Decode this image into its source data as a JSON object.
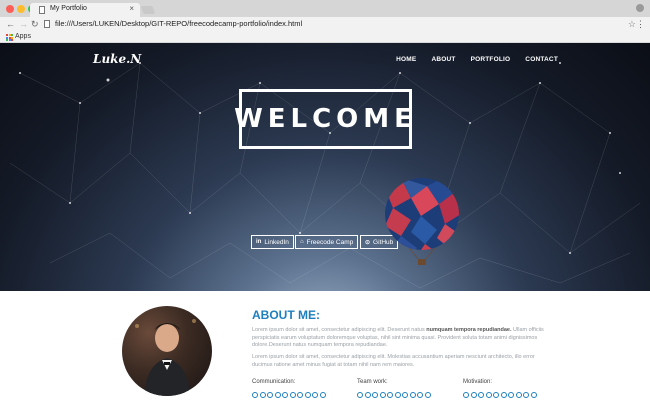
{
  "browser": {
    "tab_title": "My Portfolio",
    "url": "file:///Users/LUKEN/Desktop/GIT-REPO/freecodecamp-portfolio/index.html",
    "bookmarks": {
      "apps_label": "Apps"
    }
  },
  "site": {
    "brand": "Luke.N",
    "nav": [
      "HOME",
      "ABOUT",
      "PORTFOLIO",
      "CONTACT"
    ],
    "hero_title": "WELCOME",
    "social": [
      {
        "label": "LinkedIn",
        "icon": "in"
      },
      {
        "label": "Freecode Camp",
        "icon": "⌂"
      },
      {
        "label": "GitHub",
        "icon": "⊙"
      }
    ]
  },
  "about": {
    "title": "ABOUT ME:",
    "para1_start": "Lorem ipsum dolor sit amet, consectetur adipiscing elit. Deserunt natus ",
    "para1_bold": "numquam tempora repudiandae.",
    "para1_end": " Ullam officiis perspiciatis earum voluptatum doloremque voluptas, nihil sint minima quasi. Provident soluta totam animi dignissimos dolore.Deserunt natus numquam tempora repudiandae.",
    "para2": "Lorem ipsum dolor sit amet, consectetur adipiscing elit. Molestias accusantium aperiam nesciunt architecto, illo error ducimus ratione amet minus fugiat at totam nihil nam rem maiores.",
    "skills": [
      {
        "label": "Communication:"
      },
      {
        "label": "Team work:"
      },
      {
        "label": "Motivation:"
      }
    ]
  },
  "colors": {
    "accent": "#1e7fbf",
    "hero_dark": "#0b0e16"
  }
}
